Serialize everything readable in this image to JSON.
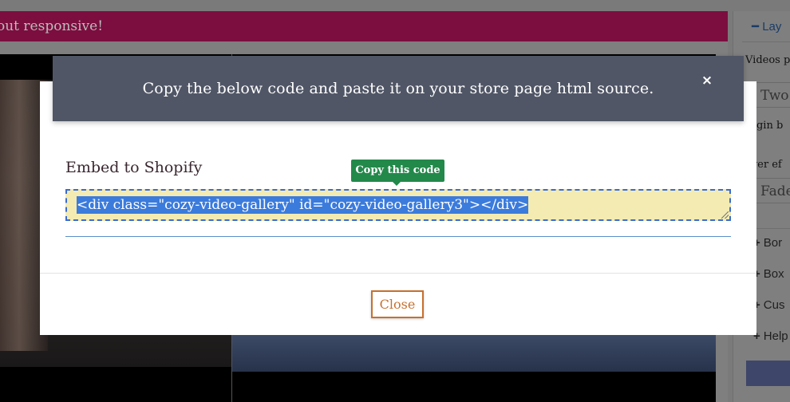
{
  "background": {
    "banner_text": "out responsive!",
    "sidebar": {
      "section_title": "Lay",
      "videos_per_row_label": "Videos p",
      "videos_per_row_value": "Two",
      "margin_label": "argin b",
      "hover_effect_label": "over ef",
      "hover_effect_value": "Fade",
      "collapsed_sections": [
        "Bor",
        "Box",
        "Cus",
        "Help"
      ]
    }
  },
  "modal": {
    "title": "Copy the below code and paste it on your store page html source.",
    "close_icon": "×",
    "embed_label": "Embed to Shopify",
    "tooltip": "Copy this code",
    "code": "<div class=\"cozy-video-gallery\" id=\"cozy-video-gallery3\"></div>",
    "close_button": "Close"
  },
  "colors": {
    "banner": "#7c0e3f",
    "modal_header": "#505666",
    "tooltip": "#22894a",
    "code_bg": "#f3ebb2",
    "selection": "#3b7bdc",
    "close_button": "#c6712f"
  }
}
